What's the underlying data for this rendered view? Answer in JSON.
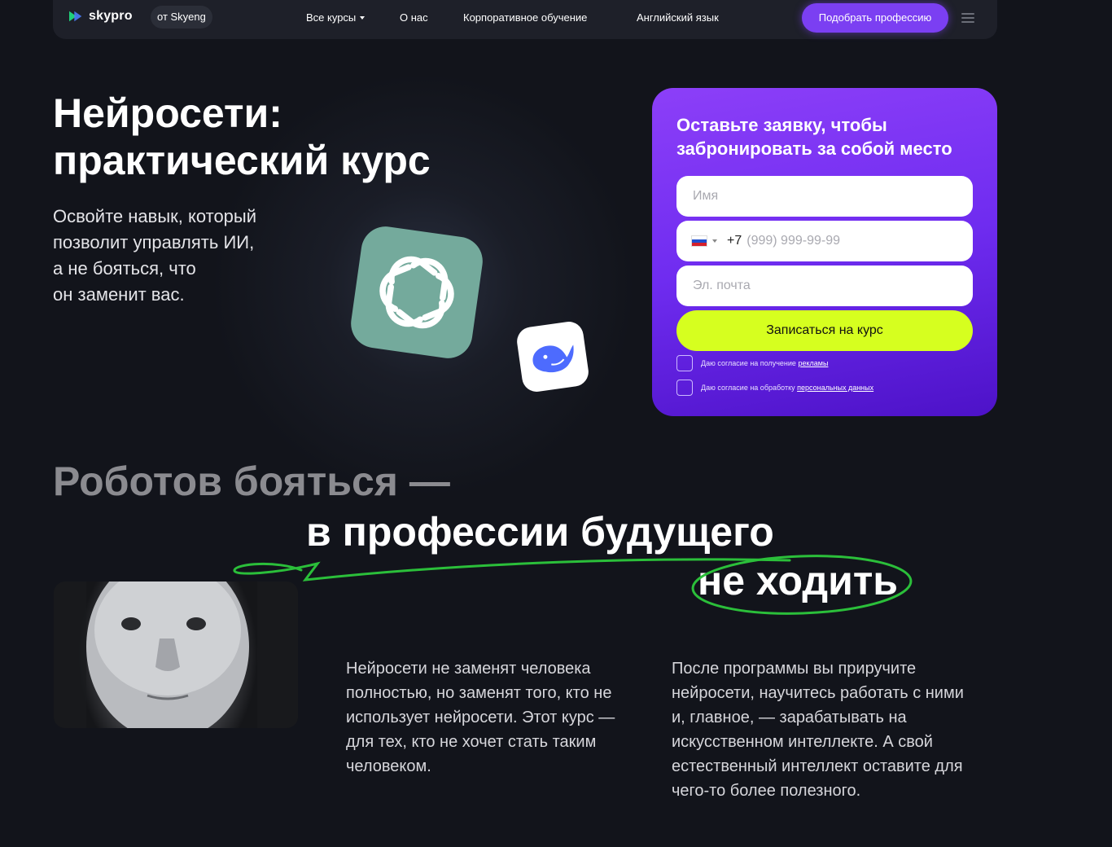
{
  "header": {
    "logo_text": "skypro",
    "by_label": "от Skyeng",
    "nav": {
      "courses": "Все курсы",
      "about": "О нас",
      "corporate": "Корпоративное обучение",
      "english": "Английский язык"
    },
    "cta": "Подобрать профессию",
    "menu_icon": "hamburger-icon"
  },
  "hero": {
    "title_line1": "Нейросети:",
    "title_line2": "практический курс",
    "subtitle_line1": "Освойте навык, который",
    "subtitle_line2": "позволит управлять ИИ,",
    "subtitle_line3": "а не бояться, что",
    "subtitle_line4": "он заменит вас.",
    "icons": [
      "chatgpt-logo-icon",
      "deepseek-whale-icon"
    ]
  },
  "form": {
    "title": "Оставьте заявку, чтобы забронировать за собой место",
    "name_placeholder": "Имя",
    "phone_code": "+7",
    "phone_placeholder": "(999) 999-99-99",
    "email_placeholder": "Эл. почта",
    "submit": "Записаться на курс",
    "consent1_text": "Даю согласие на получение ",
    "consent1_link": "рекламы",
    "consent2_text": "Даю согласие на обработку ",
    "consent2_link": "персональных данных"
  },
  "section2": {
    "heading_grey": "Роботов бояться —",
    "heading_white1": "в профессии будущего",
    "heading_white2": "не ходить",
    "para1": "Нейросети не заменят человека полностью, но заменят того, кто не использует нейросети. Этот курс — для тех, кто не хочет стать таким человеком.",
    "para2": "После программы вы приручите нейросети, научитесь работать с ними и, главное, — зарабатывать на искусственном интеллекте. А свой естественный интеллект оставите для чего-то более полезного."
  },
  "colors": {
    "background": "#11131a",
    "accent_purple": "#7b3ff2",
    "cta_lime": "#d6ff1f",
    "underline_green": "#33cc33",
    "gpt_green": "#74aa9c"
  }
}
